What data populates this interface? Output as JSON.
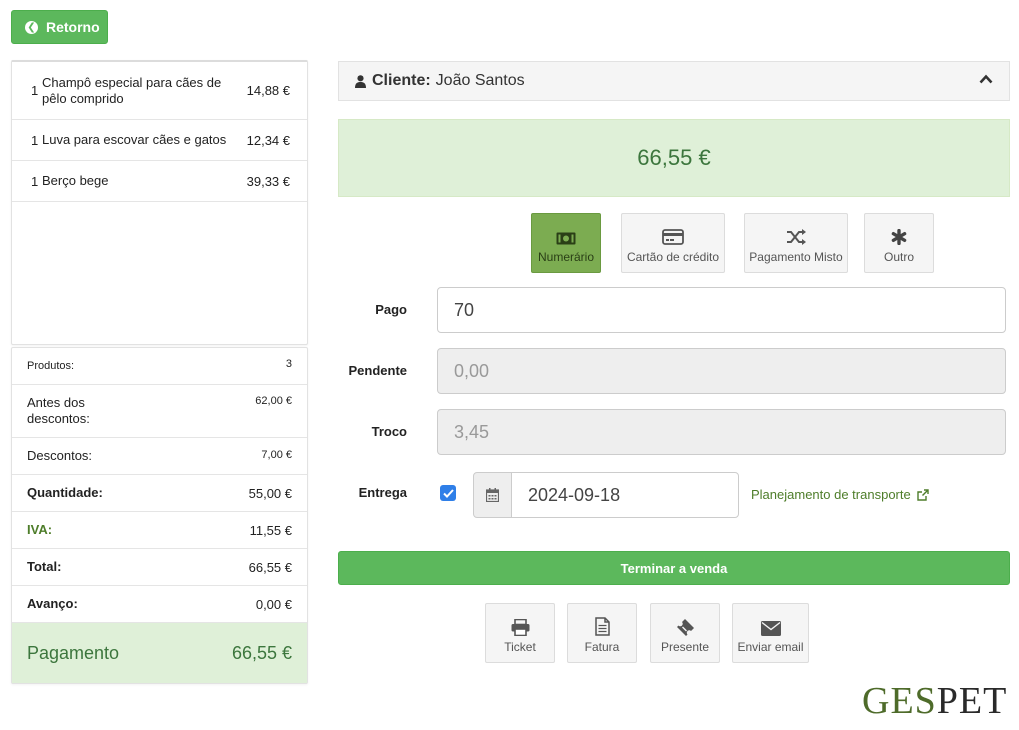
{
  "back_label": "Retorno",
  "items": [
    {
      "qty": "1",
      "name": "Champô especial para cães de pêlo comprido",
      "price": "14,88 €"
    },
    {
      "qty": "1",
      "name": "Luva para escovar cães e gatos",
      "price": "12,34 €"
    },
    {
      "qty": "1",
      "name": "Berço bege",
      "price": "39,33 €"
    }
  ],
  "summary": {
    "produtos_label": "Produtos:",
    "produtos_value": "3",
    "antes_label": "Antes dos descontos:",
    "antes_value": "62,00 €",
    "descontos_label": "Descontos:",
    "descontos_value": "7,00 €",
    "quantidade_label": "Quantidade:",
    "quantidade_value": "55,00 €",
    "iva_label": "IVA:",
    "iva_value": "11,55 €",
    "total_label": "Total:",
    "total_value": "66,55 €",
    "avanco_label": "Avanço:",
    "avanco_value": "0,00 €",
    "pagamento_label": "Pagamento",
    "pagamento_value": "66,55 €"
  },
  "client": {
    "label": "Cliente:",
    "name": "João Santos"
  },
  "total_display": "66,55 €",
  "methods": {
    "numerario": "Numerário",
    "cartao": "Cartão de crédito",
    "misto": "Pagamento Misto",
    "outro": "Outro"
  },
  "form": {
    "pago_label": "Pago",
    "pago_value": "70",
    "pendente_label": "Pendente",
    "pendente_value": "0,00",
    "troco_label": "Troco",
    "troco_value": "3,45",
    "entrega_label": "Entrega",
    "entrega_checked": true,
    "date_value": "2024-09-18",
    "transport_link": "Planejamento de transporte"
  },
  "finish_label": "Terminar a venda",
  "docs": {
    "ticket": "Ticket",
    "fatura": "Fatura",
    "presente": "Presente",
    "email": "Enviar email"
  },
  "logo": {
    "part1": "GES",
    "part2": "PET"
  },
  "colors": {
    "primary_green": "#5cb85c",
    "light_green": "#dff0d8",
    "text_green": "#3c763d",
    "active_method": "#7cac51"
  }
}
